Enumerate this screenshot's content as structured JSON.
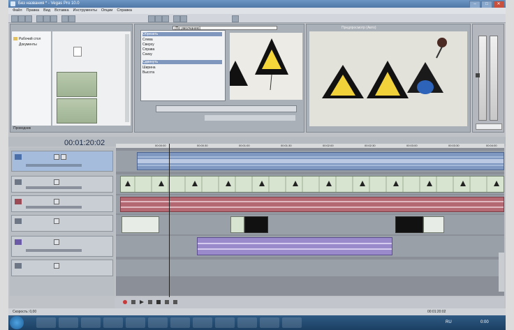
{
  "window": {
    "title": "Без названия * - Vegas Pro 10.0"
  },
  "menu": [
    "Файл",
    "Правка",
    "Вид",
    "Вставка",
    "Инструменты",
    "Опции",
    "Справка"
  ],
  "explorer": {
    "tab_label": "Проводник",
    "tree_items": [
      "Рабочий стол",
      "Документы",
      "Компьютер"
    ]
  },
  "trimmer": {
    "preset_label": "(По умолчанию)",
    "fx_sections": [
      "Обрезать",
      "Сдвинуть"
    ],
    "fx_rows": [
      "Слева",
      "Сверху",
      "Справа",
      "Снизу",
      "Ширина",
      "Высота"
    ]
  },
  "preview": {
    "label": "Предпросмотр (Авто)"
  },
  "timeline": {
    "timecode": "00:01:20:02",
    "ruler_marks": [
      "00:00:00",
      "00:00:30",
      "00:01:00",
      "00:01:30",
      "00:02:00",
      "00:02:30",
      "00:03:00",
      "00:03:30",
      "00:04:00"
    ]
  },
  "statusbar": {
    "rate": "Скорость: 0,00",
    "time": "00:01:20:02"
  },
  "taskbar": {
    "language": "RU",
    "clock": "0:00"
  },
  "colors": {
    "video_clip": "#d7e4d0",
    "audio_blue": "#7f98c2",
    "audio_red": "#b36872",
    "audio_purple": "#9b8acb"
  }
}
